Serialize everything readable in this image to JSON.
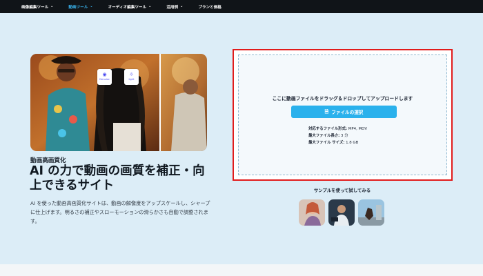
{
  "nav": {
    "items": [
      {
        "label": "画像編集ツール",
        "has_dropdown": true,
        "active": false
      },
      {
        "label": "動画ツール",
        "has_dropdown": true,
        "active": true
      },
      {
        "label": "オーディオ編集ツール",
        "has_dropdown": true,
        "active": false
      },
      {
        "label": "活用例",
        "has_dropdown": true,
        "active": false
      },
      {
        "label": "プランと価格",
        "has_dropdown": false,
        "active": false
      }
    ]
  },
  "hero": {
    "badges": [
      {
        "label": "Denoise",
        "icon": "denoise-icon"
      },
      {
        "label": "light",
        "icon": "light-bulb-icon"
      }
    ],
    "subtitle": "動画高画質化",
    "headline": "AI の力で動画の画質を補正・向上できるサイト",
    "description": "AI を使った動画高画質化サイトは、動画の解像度をアップスケールし、シャープに仕上げます。明るさの補正やスローモーションの滑らかさも自動で調整されます。"
  },
  "upload": {
    "drop_text": "ここに動画ファイルをドラッグ＆ドロップしてアップロードします",
    "button_label": "ファイルの選択",
    "specs": [
      {
        "key": "対応するファイル形式:",
        "value": " MP4, MOV"
      },
      {
        "key": "最大ファイル長さ:",
        "value": " 3 分"
      },
      {
        "key": "最大ファイル サイズ:",
        "value": " 1.8 GB"
      }
    ]
  },
  "samples": {
    "title": "サンプルを使って試してみる"
  },
  "colors": {
    "accent": "#2ab1ec",
    "nav_bg": "#101418",
    "highlight_border": "#e11b1b",
    "page_bg": "#dcedf7"
  }
}
